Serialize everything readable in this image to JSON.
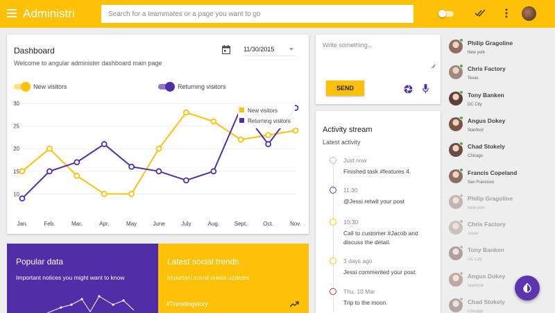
{
  "topbar": {
    "title": "Administri",
    "search_placeholder": "Search for a teammates or a page you want to go",
    "theme_toggle": "off",
    "icons": [
      "menu-icon",
      "done-all-icon",
      "more-vert-icon"
    ]
  },
  "colors": {
    "primary": "#ffc107",
    "accent": "#512da8",
    "new_visitors": "#ffc107",
    "returning_visitors": "#512da8",
    "online": "#4caf50"
  },
  "dashboard": {
    "title": "Dashboard",
    "subtitle": "Welcome to angular administer dashboard main page",
    "date": "11/30/2015",
    "toggles": [
      {
        "label": "New visitors",
        "on": true
      },
      {
        "label": "Returning visitors",
        "on": true
      }
    ]
  },
  "chart_data": {
    "type": "line",
    "categories": [
      "Jan.",
      "Feb.",
      "Mar.",
      "Apr.",
      "May",
      "June",
      "July",
      "Aug.",
      "Sept.",
      "Oct.",
      "Nov."
    ],
    "ylim": [
      5,
      30
    ],
    "yticks": [
      10,
      15,
      20,
      25,
      30
    ],
    "series": [
      {
        "name": "New visitors",
        "color": "#ffc107",
        "values": [
          15,
          20,
          14,
          10,
          10,
          20,
          28,
          26,
          22,
          23,
          24
        ]
      },
      {
        "name": "Returning visitors",
        "color": "#512da8",
        "values": [
          9,
          15,
          17,
          21,
          16,
          15,
          13,
          15,
          29,
          21,
          29
        ]
      }
    ],
    "legend": "top-right",
    "grid": "horizontal"
  },
  "composer": {
    "placeholder": "Write something...",
    "send_label": "SEND",
    "icons": [
      "camera-iris-icon",
      "microphone-icon"
    ]
  },
  "activity": {
    "title": "Activity stream",
    "subtitle": "Latest activity",
    "items": [
      {
        "time": "Just now",
        "text": "Finished task #features 4.",
        "color": "#bdbdbd"
      },
      {
        "time": "11:30",
        "text": "@Jessi retwit your post",
        "color": "#3f51b5"
      },
      {
        "time": "10:30",
        "text": "Call to customer #Jacob and discuss the detail.",
        "color": "#ffc107"
      },
      {
        "time": "3 days ago",
        "text": "Jessi commented your post.",
        "color": "#ffc107"
      },
      {
        "time": "Thu, 10 Mar",
        "text": "Trip to the moon",
        "color": "#c62828"
      }
    ]
  },
  "panels": {
    "popular": {
      "title": "Popular data",
      "subtitle": "Important notices you might want to know"
    },
    "social": {
      "title": "Latest social trends",
      "subtitle": "Important social media updates",
      "tag": "#Trendingstory"
    }
  },
  "users": [
    {
      "name": "Philip Gragoline",
      "city": "New york",
      "online": true,
      "avatar": "#8d6e63"
    },
    {
      "name": "Chris Factory",
      "city": "Texas",
      "online": true,
      "avatar": "#a1887f"
    },
    {
      "name": "Tony Banken",
      "city": "DC City",
      "online": true,
      "avatar": "#5d4037"
    },
    {
      "name": "Angus Dokey",
      "city": "Stanford",
      "online": true,
      "avatar": "#795548"
    },
    {
      "name": "Chad Stokely",
      "city": "Chicago",
      "online": true,
      "avatar": "#6d4c41"
    },
    {
      "name": "Francis Copeland",
      "city": "San Francisco",
      "online": true,
      "avatar": "#8d6e63"
    },
    {
      "name": "Philip Gragoline",
      "city": "New york",
      "online": false,
      "avatar": "#8d6e63"
    },
    {
      "name": "Chris Factory",
      "city": "Texas",
      "online": false,
      "avatar": "#a1887f"
    },
    {
      "name": "Tony Banken",
      "city": "DC City",
      "online": false,
      "avatar": "#5d4037"
    },
    {
      "name": "Angus Dokey",
      "city": "Stanford",
      "online": false,
      "avatar": "#795548"
    },
    {
      "name": "Chad Stokely",
      "city": "Chicago",
      "online": false,
      "avatar": "#6d4c41"
    }
  ],
  "fab": {
    "icon": "invert-colors-icon"
  }
}
